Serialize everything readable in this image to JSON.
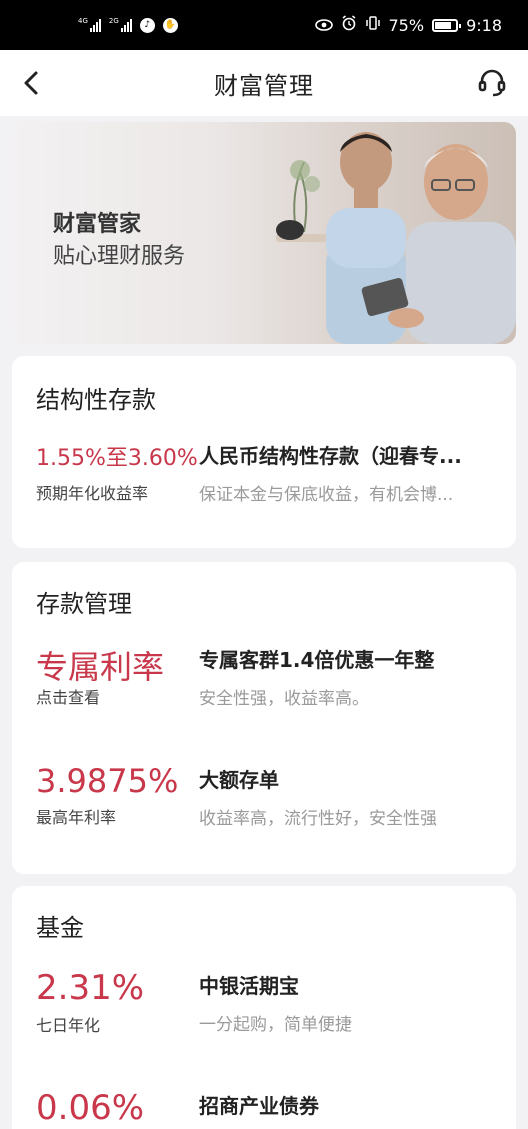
{
  "status_bar": {
    "signal1": "4G",
    "signal2": "2G",
    "battery": "75%",
    "time": "9:18"
  },
  "nav": {
    "title": "财富管理",
    "back_icon": "chevron-left-icon",
    "service_icon": "headset-icon"
  },
  "banner": {
    "title": "财富管家",
    "subtitle": "贴心理财服务"
  },
  "structured_deposit": {
    "title": "结构性存款",
    "products": [
      {
        "rate": "1.55%至3.60%",
        "rate_label": "预期年化收益率",
        "name": "人民币结构性存款（迎春专...",
        "desc": "保证本金与保底收益，有机会博..."
      }
    ]
  },
  "deposit_management": {
    "title": "存款管理",
    "products": [
      {
        "rate": "专属利率",
        "rate_label": "点击查看",
        "name": "专属客群1.4倍优惠一年整",
        "desc": "安全性强，收益率高。"
      },
      {
        "rate": "3.9875%",
        "rate_label": "最高年利率",
        "name": "大额存单",
        "desc": "收益率高，流行性好，安全性强"
      }
    ]
  },
  "funds": {
    "title": "基金",
    "products": [
      {
        "rate": "2.31%",
        "rate_label": "七日年化",
        "name": "中银活期宝",
        "desc": "一分起购，简单便捷"
      },
      {
        "rate": "0.06%",
        "rate_label": "",
        "name": "招商产业债券",
        "desc": ""
      }
    ]
  },
  "colors": {
    "accent_red": "#c8374a",
    "muted_text": "#9a9a9a"
  }
}
